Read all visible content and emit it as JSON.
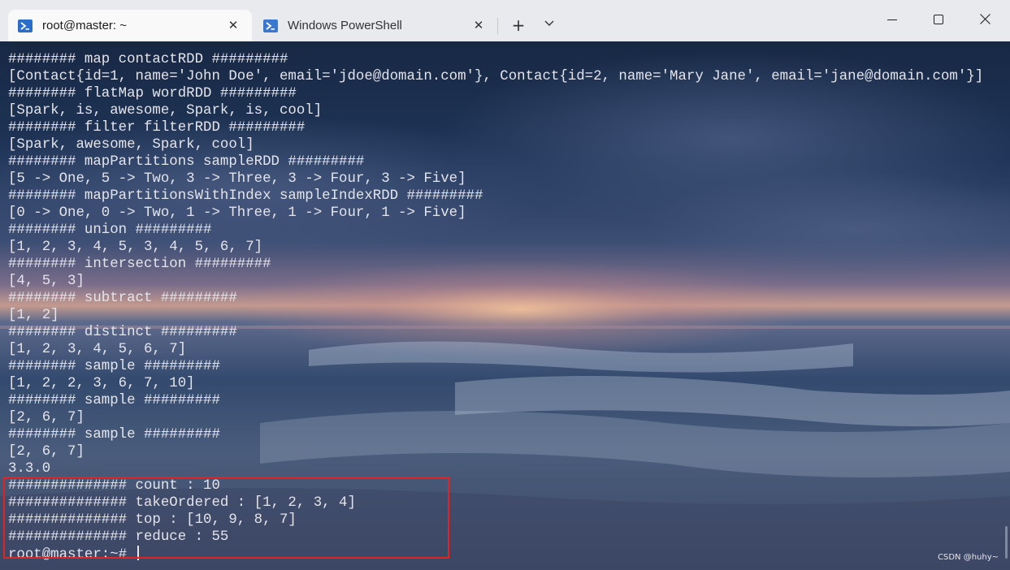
{
  "tabs": [
    {
      "title": "root@master: ~",
      "icon": "powershell-icon",
      "active": true
    },
    {
      "title": "Windows PowerShell",
      "icon": "powershell-icon",
      "active": false
    }
  ],
  "tab_controls": {
    "new_tab": "+",
    "dropdown": "⌵",
    "close": "✕"
  },
  "window_controls": {
    "minimize": "—",
    "maximize": "☐",
    "close": "✕"
  },
  "terminal": {
    "lines": [
      "######## map contactRDD #########",
      "[Contact{id=1, name='John Doe', email='jdoe@domain.com'}, Contact{id=2, name='Mary Jane', email='jane@domain.com'}]",
      "######## flatMap wordRDD #########",
      "[Spark, is, awesome, Spark, is, cool]",
      "######## filter filterRDD #########",
      "[Spark, awesome, Spark, cool]",
      "######## mapPartitions sampleRDD #########",
      "[5 -> One, 5 -> Two, 3 -> Three, 3 -> Four, 3 -> Five]",
      "######## mapPartitionsWithIndex sampleIndexRDD #########",
      "[0 -> One, 0 -> Two, 1 -> Three, 1 -> Four, 1 -> Five]",
      "######## union #########",
      "[1, 2, 3, 4, 5, 3, 4, 5, 6, 7]",
      "######## intersection #########",
      "[4, 5, 3]",
      "######## subtract #########",
      "[1, 2]",
      "######## distinct #########",
      "[1, 2, 3, 4, 5, 6, 7]",
      "######## sample #########",
      "[1, 2, 2, 3, 6, 7, 10]",
      "######## sample #########",
      "[2, 6, 7]",
      "######## sample #########",
      "[2, 6, 7]",
      "3.3.0",
      "############## count : 10",
      "############## takeOrdered : [1, 2, 3, 4]",
      "############## top : [10, 9, 8, 7]",
      "############## reduce : 55"
    ],
    "prompt": "root@master:~# "
  },
  "watermark": "CSDN @huhy~",
  "colors": {
    "highlight_border": "#e02424",
    "terminal_text": "#e4e4ea",
    "tab_bar": "#e8eaee"
  }
}
